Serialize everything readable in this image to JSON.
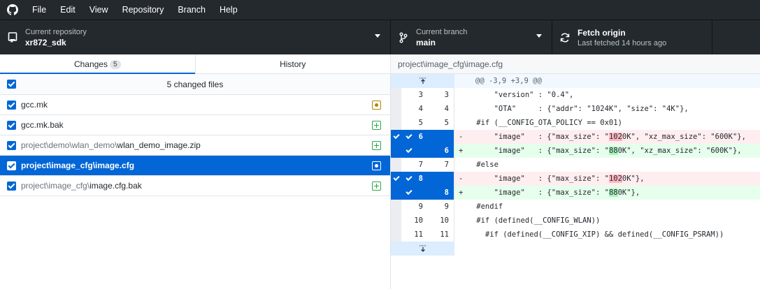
{
  "menu": [
    "File",
    "Edit",
    "View",
    "Repository",
    "Branch",
    "Help"
  ],
  "toolbar": {
    "repo_label": "Current repository",
    "repo_value": "xr872_sdk",
    "branch_label": "Current branch",
    "branch_value": "main",
    "fetch_label": "Fetch origin",
    "fetch_sub": "Last fetched 14 hours ago"
  },
  "tabs": {
    "changes": "Changes",
    "changes_count": "5",
    "history": "History"
  },
  "changes_summary": "5 changed files",
  "files": [
    {
      "dir": "",
      "name": "gcc.mk",
      "status": "modified"
    },
    {
      "dir": "",
      "name": "gcc.mk.bak",
      "status": "added"
    },
    {
      "dir": "project\\demo\\wlan_demo\\",
      "name": "wlan_demo_image.zip",
      "status": "added"
    },
    {
      "dir": "project\\image_cfg\\",
      "name": "image.cfg",
      "status": "modified",
      "selected": true
    },
    {
      "dir": "project\\image_cfg\\",
      "name": "image.cfg.bak",
      "status": "added"
    }
  ],
  "diff": {
    "path": "project\\image_cfg\\image.cfg",
    "hunk": "@@ -3,9 +3,9 @@",
    "lines": [
      {
        "type": "ctx",
        "old": "3",
        "new": "3",
        "text": "        \"version\" : \"0.4\","
      },
      {
        "type": "ctx",
        "old": "4",
        "new": "4",
        "text": "        \"OTA\"     : {\"addr\": \"1024K\", \"size\": \"4K\"},"
      },
      {
        "type": "ctx",
        "old": "5",
        "new": "5",
        "text": "    #if (__CONFIG_OTA_POLICY == 0x01)"
      },
      {
        "type": "del",
        "old": "6",
        "new": "",
        "pre": "-       \"image\"   : {\"max_size\": \"",
        "hl": "102",
        "post": "0K\", \"xz_max_size\": \"600K\"},"
      },
      {
        "type": "add",
        "old": "",
        "new": "6",
        "pre": "+       \"image\"   : {\"max_size\": \"",
        "hl": "88",
        "post": "0K\", \"xz_max_size\": \"600K\"},"
      },
      {
        "type": "ctx",
        "old": "7",
        "new": "7",
        "text": "    #else"
      },
      {
        "type": "del",
        "old": "8",
        "new": "",
        "pre": "-       \"image\"   : {\"max_size\": \"",
        "hl": "102",
        "post": "0K\"},"
      },
      {
        "type": "add",
        "old": "",
        "new": "8",
        "pre": "+       \"image\"   : {\"max_size\": \"",
        "hl": "88",
        "post": "0K\"},"
      },
      {
        "type": "ctx",
        "old": "9",
        "new": "9",
        "text": "    #endif"
      },
      {
        "type": "ctx",
        "old": "10",
        "new": "10",
        "text": "    #if (defined(__CONFIG_WLAN))"
      },
      {
        "type": "ctx",
        "old": "11",
        "new": "11",
        "text": "      #if (defined(__CONFIG_XIP) && defined(__CONFIG_PSRAM))"
      }
    ]
  }
}
